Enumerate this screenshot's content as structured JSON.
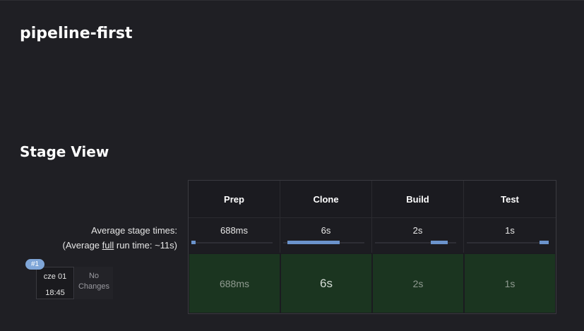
{
  "job": {
    "title": "pipeline-first"
  },
  "stage_view": {
    "title": "Stage View",
    "avg_label": "Average stage times:",
    "avg_full_prefix": "(Average ",
    "avg_full_word": "full",
    "avg_full_suffix": " run time: ~11s)",
    "stages": [
      {
        "name": "Prep",
        "avg": "688ms",
        "avg_fraction": 0.05
      },
      {
        "name": "Clone",
        "avg": "6s",
        "avg_fraction": 0.64
      },
      {
        "name": "Build",
        "avg": "2s",
        "avg_fraction": 0.21
      },
      {
        "name": "Test",
        "avg": "1s",
        "avg_fraction": 0.11
      }
    ],
    "runs": [
      {
        "badge": "#1",
        "date": "cze 01",
        "time": "18:45",
        "changes": "No Changes",
        "cells": [
          "688ms",
          "6s",
          "2s",
          "1s"
        ],
        "status_color": "#1b3520"
      }
    ],
    "colors": {
      "avg_bar": "#6b93cc",
      "success_cell": "#1b3520",
      "badge": "#7fa6d8"
    }
  }
}
